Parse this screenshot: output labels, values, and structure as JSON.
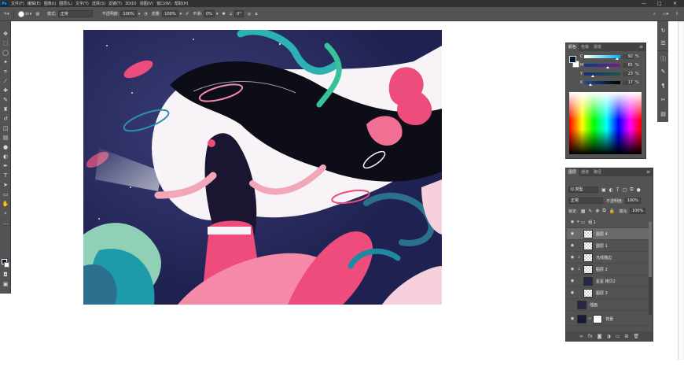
{
  "menubar": {
    "logo": "Ps",
    "items": [
      "文件(F)",
      "编辑(E)",
      "图像(I)",
      "图层(L)",
      "文字(Y)",
      "选择(S)",
      "滤镜(T)",
      "3D(D)",
      "视图(V)",
      "窗口(W)",
      "帮助(H)"
    ],
    "minimize": "—",
    "maximize": "□",
    "close": "✕"
  },
  "options": {
    "brush_size": "30",
    "mode_label": "模式:",
    "mode_value": "正常",
    "opacity_label": "不透明度:",
    "opacity_value": "100%",
    "flow_label": "流量:",
    "flow_value": "100%",
    "smoothing_label": "平滑:",
    "smoothing_value": "0%",
    "angle_value": "0°"
  },
  "color_panel": {
    "tabs": [
      "颜色",
      "色板",
      "渐变"
    ],
    "rows": [
      {
        "label": "C",
        "value": "92",
        "knob": 0.92
      },
      {
        "label": "M",
        "value": "65",
        "knob": 0.65
      },
      {
        "label": "Y",
        "value": "23",
        "knob": 0.23
      },
      {
        "label": "K",
        "value": "17",
        "knob": 0.17
      }
    ],
    "percent": "%",
    "fg_color": "#0a1733"
  },
  "layers_panel": {
    "tabs": [
      "图层",
      "通道",
      "路径"
    ],
    "kind_label": "Q 类型",
    "blend_mode": "正常",
    "opacity_label": "不透明度:",
    "opacity_value": "100%",
    "lock_label": "锁定:",
    "fill_label": "填充:",
    "fill_value": "100%",
    "layers": [
      {
        "name": "组 1",
        "type": "group"
      },
      {
        "name": "图层 4",
        "type": "layer"
      },
      {
        "name": "图层 1",
        "type": "layer"
      },
      {
        "name": "光线描边",
        "type": "clip"
      },
      {
        "name": "图层 2",
        "type": "clip"
      },
      {
        "name": "星星 拷贝2",
        "type": "art"
      },
      {
        "name": "图层 3",
        "type": "layer"
      },
      {
        "name": "插画",
        "type": "art"
      },
      {
        "name": "背景",
        "type": "bg"
      }
    ]
  },
  "colors": {
    "ui_dark": "#323232",
    "ui_panel": "#535353",
    "art_navy": "#222552",
    "art_pink": "#ee4c7c",
    "art_teal": "#2db1b4",
    "art_black": "#0d0d18"
  }
}
